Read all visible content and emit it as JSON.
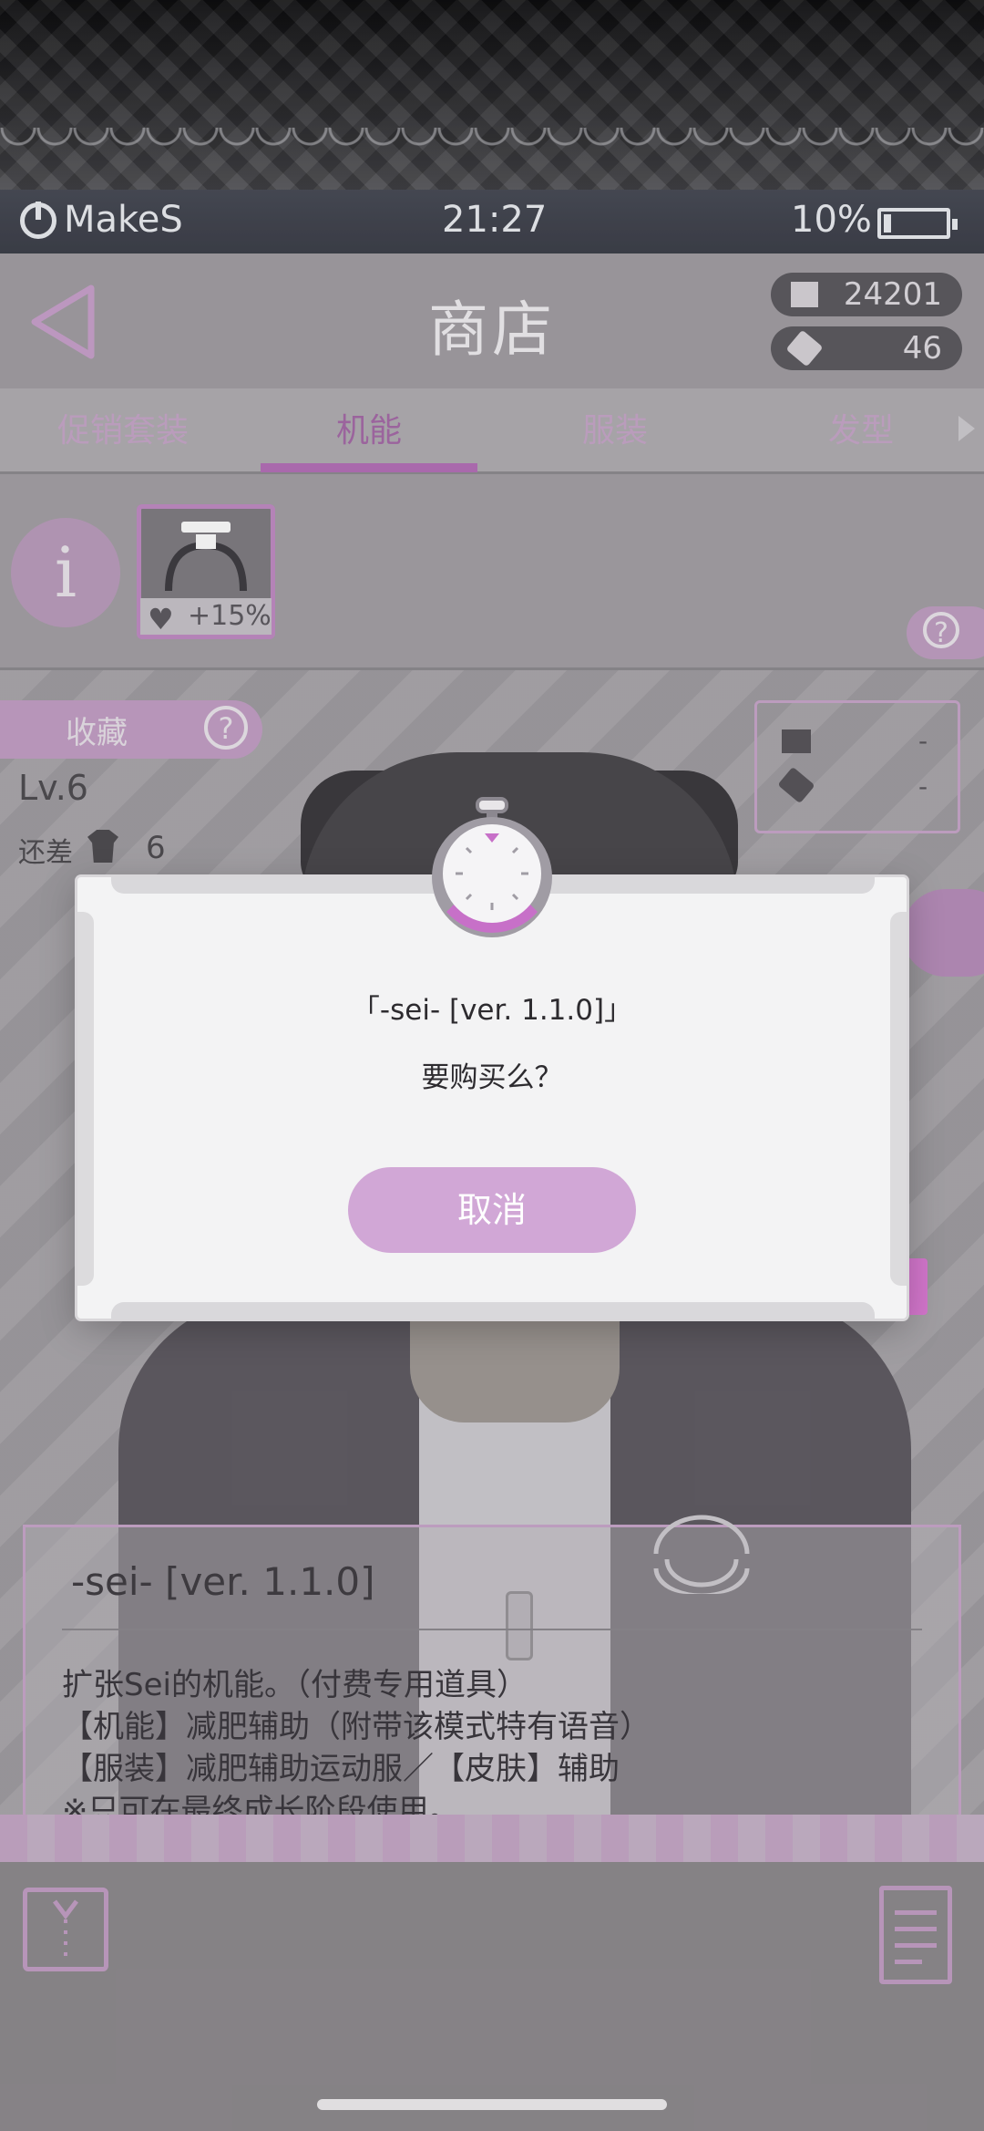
{
  "status_bar": {
    "brand": "MakeS",
    "time": "21:27",
    "battery": "10%",
    "battery_level": 0.1
  },
  "header": {
    "title": "商店",
    "currency_coins": "24201",
    "currency_tickets": "46"
  },
  "tabs": [
    {
      "label": "促销套装"
    },
    {
      "label": "机能"
    },
    {
      "label": "服装"
    },
    {
      "label": "发型"
    }
  ],
  "active_tab": "机能",
  "item": {
    "bonus": "+15%"
  },
  "favorites": {
    "label": "收藏"
  },
  "progress": {
    "level": "Lv.6",
    "remain_label": "还差",
    "remain_count": "6"
  },
  "price": {
    "coin": "-",
    "ticket": "-"
  },
  "description": {
    "title": "-sei- [ver. 1.1.0]",
    "lines": [
      "扩张Sei的机能。（付费专用道具）",
      "【机能】减肥辅助（附带该模式特有语音）",
      "【服装】减肥辅助运动服／【皮肤】辅助",
      "※只可在最终成长阶段使用。"
    ]
  },
  "dialog": {
    "title": "「-sei- [ver. 1.1.0]」",
    "question": "要购买么？",
    "cancel_label": "取消"
  },
  "colors": {
    "accent": "#d1a7d6",
    "active_tab": "#b56fb8",
    "header_bg": "#a29ea3"
  }
}
